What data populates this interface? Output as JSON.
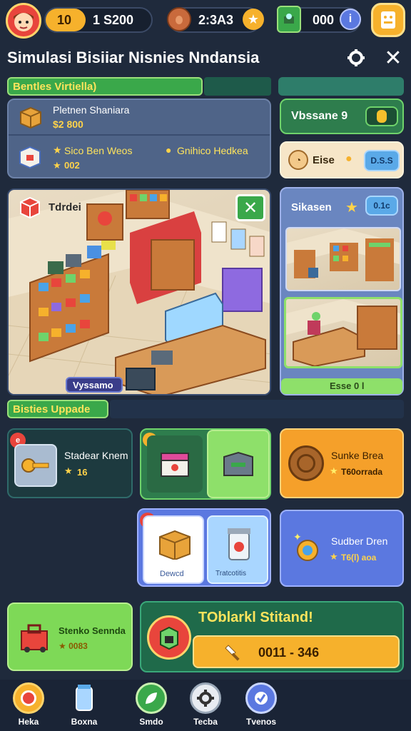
{
  "topbar": {
    "level": "10",
    "xp": "1 S200",
    "timer": "2:3A3",
    "gems": "000",
    "info_glyph": "i"
  },
  "header": {
    "title": "Simulasi Bisiiar Nisnies Nndansia"
  },
  "section_main": {
    "label": "Bentles Virtiella)"
  },
  "item_list": [
    {
      "name": "Pletnen Shaniara",
      "price": "$2 800"
    },
    {
      "name": "Sico Ben Weos",
      "extra": "Gnihico Hedkea",
      "price": "002"
    }
  ],
  "side_cards": {
    "level_card": "Vbssane 9",
    "boost_card_label": "Eise",
    "boost_card_button": "D.S.S"
  },
  "scene": {
    "tag_label": "Tdrdei",
    "badge_label": "Vyssamo"
  },
  "right_panel": {
    "title": "Sikasen",
    "button": "0.1c",
    "bottom_label": "Esse 0 l"
  },
  "section_upgrade": {
    "label": "Bisties Uppade"
  },
  "upgrades": [
    {
      "name": "Stadear Knem",
      "value": "16",
      "badge": "e"
    },
    {
      "name": "Sunke Brea",
      "value": "T60orrada"
    },
    {
      "label_left": "Dewcd",
      "label_right": "Tratcotitis",
      "badge": "uu"
    },
    {
      "name": "Sudber Dren",
      "value": "T6(l) aoa"
    }
  ],
  "bottom_cards": {
    "left_name": "Stenko Sennda",
    "left_value": "★ 0083",
    "big_title": "TOblarkl Stitand!",
    "big_value": "0011 - 346"
  },
  "nav": [
    {
      "label": "Heka",
      "icon": "home-icon"
    },
    {
      "label": "Boxna",
      "icon": "jar-icon"
    },
    {
      "label": "Smdo",
      "icon": "leaf-icon"
    },
    {
      "label": "Tecba",
      "icon": "gear-icon"
    },
    {
      "label": "Tvenos",
      "icon": "check-icon"
    }
  ],
  "colors": {
    "background": "#1f2a3c",
    "accent_green": "#2e7d4d",
    "accent_orange": "#f5a02a",
    "accent_blue": "#5b78e0"
  }
}
